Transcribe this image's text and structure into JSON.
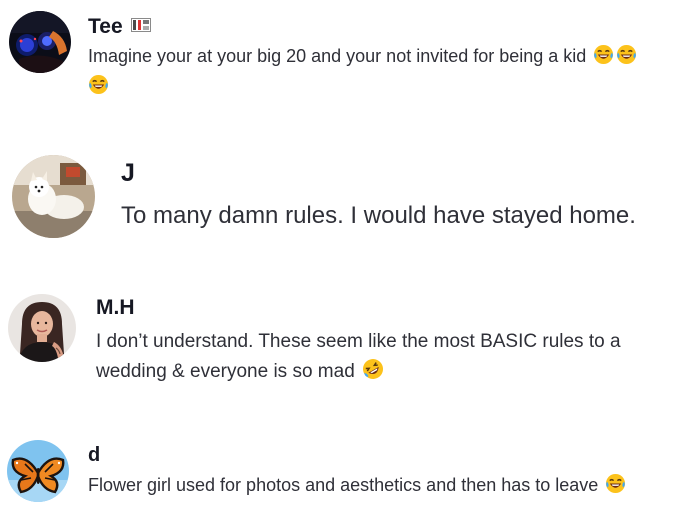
{
  "comments": [
    {
      "username": "Tee",
      "flag_icon": "flag-icon",
      "text": "Imagine your at your big 20 and your not invited for being a kid",
      "emojis": [
        "laughing-crying-emoji",
        "laughing-crying-emoji",
        "laughing-crying-emoji"
      ]
    },
    {
      "username": "J",
      "text": "To many damn rules. I would have stayed home.",
      "emojis": []
    },
    {
      "username": "M.H",
      "text": "I don’t understand. These seem like the most BASIC rules to a wedding & everyone is so mad",
      "emojis": [
        "rolling-on-floor-laughing-emoji"
      ]
    },
    {
      "username": "d",
      "text": "Flower girl used for photos and aesthetics and then has to leave",
      "emojis": [
        "laughing-crying-emoji"
      ]
    }
  ],
  "colors": {
    "username": "#161823",
    "comment_text": "#2f3038",
    "emoji_face": "#fcc21b",
    "tears": "#40a7f4"
  }
}
